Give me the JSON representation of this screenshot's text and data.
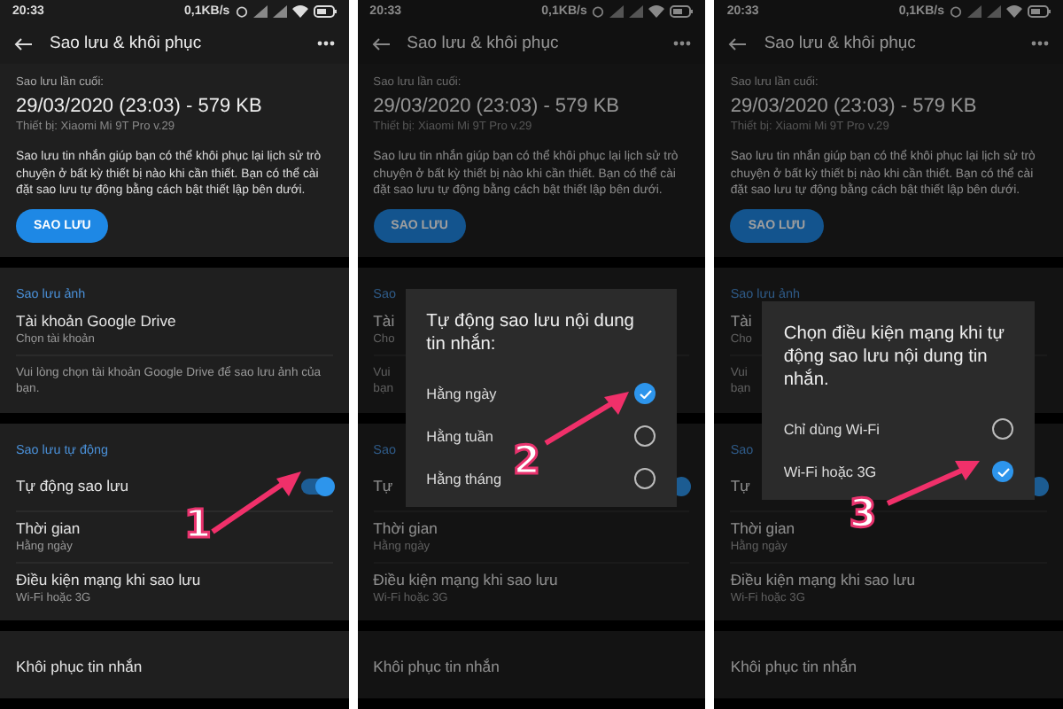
{
  "panels": [
    {
      "dimmed": false,
      "status": {
        "time": "20:33",
        "speed": "0,1KB/s"
      },
      "title": "Sao lưu & khôi phục",
      "last_backup": {
        "label": "Sao lưu lần cuối:",
        "date": "29/03/2020 (23:03) - 579 KB",
        "device": "Thiết bị: Xiaomi Mi 9T Pro v.29"
      },
      "description": "Sao lưu tin nhắn giúp bạn có thể khôi phục lại lịch sử trò chuyện ở bất kỳ thiết bị nào khi cần thiết. Bạn có thể cài đặt sao lưu tự động bằng cách bật thiết lập bên dưới.",
      "button": "SAO LƯU",
      "sections": [
        {
          "title": "Sao lưu ảnh",
          "rows": [
            {
              "kind": "item",
              "title": "Tài khoản Google Drive",
              "subtitle": "Chọn tài khoản"
            },
            {
              "kind": "note",
              "title": "Vui lòng chọn tài khoản Google Drive để sao lưu ảnh của bạn."
            }
          ]
        },
        {
          "title": "Sao lưu tự động",
          "rows": [
            {
              "kind": "toggle",
              "title": "Tự động sao lưu",
              "on": true
            },
            {
              "kind": "item",
              "title": "Thời gian",
              "subtitle": "Hằng ngày"
            },
            {
              "kind": "item",
              "title": "Điều kiện mạng khi sao lưu",
              "subtitle": "Wi-Fi hoặc 3G"
            }
          ]
        },
        {
          "rows": [
            {
              "kind": "item",
              "title": "Khôi phục tin nhắn"
            }
          ]
        }
      ],
      "annotation": "1"
    },
    {
      "dimmed": true,
      "status": {
        "time": "20:33",
        "speed": "0,1KB/s"
      },
      "title": "Sao lưu & khôi phục",
      "last_backup": {
        "label": "Sao lưu lần cuối:",
        "date": "29/03/2020 (23:03) - 579 KB",
        "device": "Thiết bị: Xiaomi Mi 9T Pro v.29"
      },
      "description": "Sao lưu tin nhắn giúp bạn có thể khôi phục lại lịch sử trò chuyện ở bất kỳ thiết bị nào khi cần thiết. Bạn có thể cài đặt sao lưu tự động bằng cách bật thiết lập bên dưới.",
      "button": "SAO LƯU",
      "sections": [
        {
          "title": "Sao",
          "rows": [
            {
              "kind": "item",
              "title": "Tài",
              "subtitle": "Cho"
            },
            {
              "kind": "note",
              "title": "Vui\nbạn"
            }
          ]
        },
        {
          "title": "Sao",
          "rows": [
            {
              "kind": "toggle",
              "title": "Tự",
              "on": true
            },
            {
              "kind": "item",
              "title": "Thời gian",
              "subtitle": "Hằng ngày"
            },
            {
              "kind": "item",
              "title": "Điều kiện mạng khi sao lưu",
              "subtitle": "Wi-Fi hoặc 3G"
            }
          ]
        },
        {
          "rows": [
            {
              "kind": "item",
              "title": "Khôi phục tin nhắn"
            }
          ]
        }
      ],
      "dialog": {
        "title": "Tự động sao lưu nội dung tin nhắn:",
        "options": [
          {
            "label": "Hằng ngày",
            "selected": true
          },
          {
            "label": "Hằng tuần",
            "selected": false
          },
          {
            "label": "Hằng tháng",
            "selected": false
          }
        ]
      },
      "annotation": "2"
    },
    {
      "dimmed": true,
      "status": {
        "time": "20:33",
        "speed": "0,1KB/s"
      },
      "title": "Sao lưu & khôi phục",
      "last_backup": {
        "label": "Sao lưu lần cuối:",
        "date": "29/03/2020 (23:03) - 579 KB",
        "device": "Thiết bị: Xiaomi Mi 9T Pro v.29"
      },
      "description": "Sao lưu tin nhắn giúp bạn có thể khôi phục lại lịch sử trò chuyện ở bất kỳ thiết bị nào khi cần thiết. Bạn có thể cài đặt sao lưu tự động bằng cách bật thiết lập bên dưới.",
      "button": "SAO LƯU",
      "sections": [
        {
          "title": "Sao lưu ảnh",
          "rows": [
            {
              "kind": "item",
              "title": "Tài",
              "subtitle": "Cho"
            },
            {
              "kind": "note",
              "title": "Vui\nbạn"
            }
          ]
        },
        {
          "title": "Sao",
          "rows": [
            {
              "kind": "toggle",
              "title": "Tự",
              "on": true
            },
            {
              "kind": "item",
              "title": "Thời gian",
              "subtitle": "Hằng ngày"
            },
            {
              "kind": "item",
              "title": "Điều kiện mạng khi sao lưu",
              "subtitle": "Wi-Fi hoặc 3G"
            }
          ]
        },
        {
          "rows": [
            {
              "kind": "item",
              "title": "Khôi phục tin nhắn"
            }
          ]
        }
      ],
      "dialog": {
        "title": "Chọn điều kiện mạng khi tự động sao lưu nội dung tin nhắn.",
        "options": [
          {
            "label": "Chỉ dùng Wi-Fi",
            "selected": false
          },
          {
            "label": "Wi-Fi hoặc 3G",
            "selected": true
          }
        ]
      },
      "annotation": "3"
    }
  ]
}
